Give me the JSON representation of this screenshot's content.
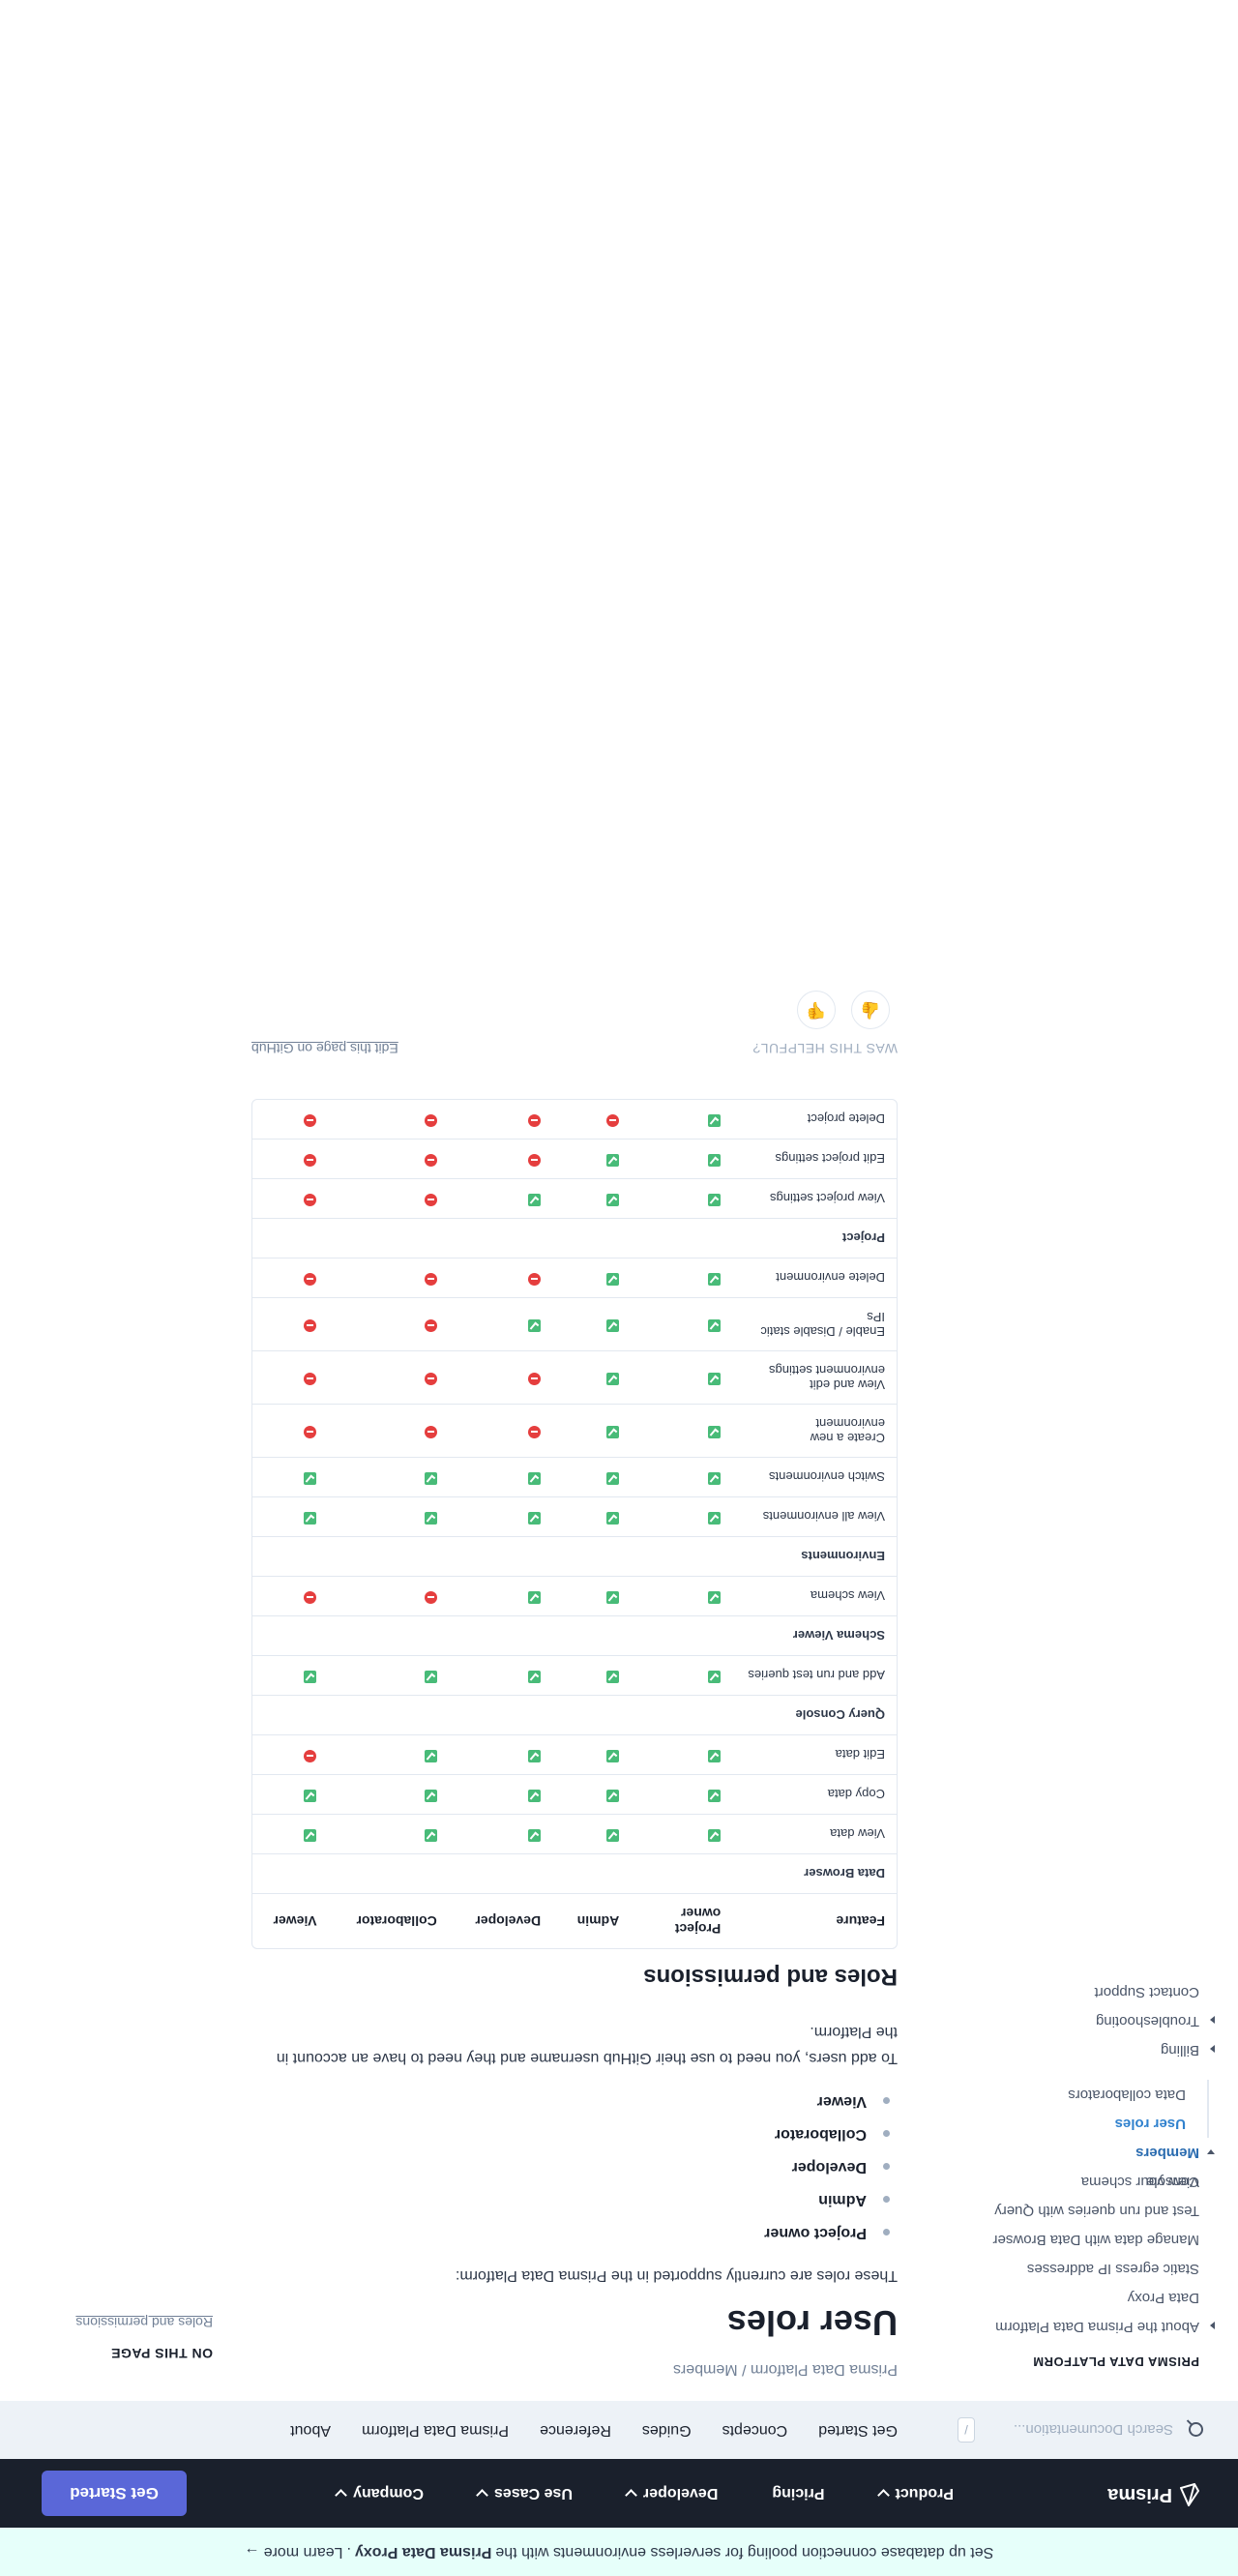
{
  "announcement": {
    "text": "Set up database connection pooling for serverless environments with the",
    "bold": "Prisma Data Proxy",
    "suffix": ".",
    "more": "Learn more",
    "arrow": "→"
  },
  "nav": {
    "logo": "Prisma",
    "links": [
      {
        "label": "Product",
        "dropdown": true
      },
      {
        "label": "Pricing",
        "dropdown": false
      },
      {
        "label": "Developer",
        "dropdown": true
      },
      {
        "label": "Use Cases",
        "dropdown": true
      },
      {
        "label": "Company",
        "dropdown": true
      }
    ],
    "cta": "Get Started"
  },
  "subnav": {
    "search_placeholder": "Search Documentation...",
    "shortcut": "/",
    "tabs": [
      "Get Started",
      "Concepts",
      "Guides",
      "Reference",
      "Prisma Data Platform",
      "About"
    ]
  },
  "sidebar": {
    "title": "PRISMA DATA PLATFORM",
    "items": [
      {
        "label": "About the Prisma Data Platform",
        "expandable": true
      },
      {
        "label": "Data Proxy"
      },
      {
        "label": "Static egress IP addresses"
      },
      {
        "label": "Manage data with Data Browser"
      },
      {
        "label": "Test and run queries with Query Console"
      },
      {
        "label": "View your schema"
      }
    ],
    "members": {
      "label": "Members",
      "children": [
        "User roles",
        "Data collaborators"
      ]
    },
    "after": [
      {
        "label": "Billing",
        "expandable": true
      },
      {
        "label": "Troubleshooting",
        "expandable": true
      },
      {
        "label": "Contact Support"
      }
    ]
  },
  "main": {
    "breadcrumb": "Prisma Data Platform / Members",
    "title": "User roles",
    "intro": "These roles are currently supported in the Prisma Data Platform:",
    "roles": [
      "Project owner",
      "Admin",
      "Developer",
      "Collaborator",
      "Viewer"
    ],
    "add_users": "To add users, you need to use their GitHub username and they need to have an account in the Platform.",
    "perm_heading": "Roles and permissions",
    "table": {
      "headers": [
        "Feature",
        "Project owner",
        "Admin",
        "Developer",
        "Collaborator",
        "Viewer"
      ],
      "rows": [
        {
          "section": "Data Browser"
        },
        {
          "feature": "View data",
          "perms": [
            "yes",
            "yes",
            "yes",
            "yes",
            "yes"
          ]
        },
        {
          "feature": "Copy data",
          "perms": [
            "yes",
            "yes",
            "yes",
            "yes",
            "yes"
          ]
        },
        {
          "feature": "Edit data",
          "perms": [
            "yes",
            "yes",
            "yes",
            "yes",
            "no"
          ]
        },
        {
          "section": "Query Console"
        },
        {
          "feature": "Add and run test queries",
          "perms": [
            "yes",
            "yes",
            "yes",
            "yes",
            "yes"
          ]
        },
        {
          "section": "Schema Viewer"
        },
        {
          "feature": "View schema",
          "perms": [
            "yes",
            "yes",
            "yes",
            "no",
            "no"
          ]
        },
        {
          "section": "Environments"
        },
        {
          "feature": "View all environments",
          "perms": [
            "yes",
            "yes",
            "yes",
            "yes",
            "yes"
          ]
        },
        {
          "feature": "Switch environments",
          "perms": [
            "yes",
            "yes",
            "yes",
            "yes",
            "yes"
          ]
        },
        {
          "feature": "Create a new environment",
          "perms": [
            "yes",
            "yes",
            "no",
            "no",
            "no"
          ]
        },
        {
          "feature": "View and edit environment settings",
          "perms": [
            "yes",
            "yes",
            "no",
            "no",
            "no"
          ]
        },
        {
          "feature": "Enable / Disable static IPs",
          "perms": [
            "yes",
            "yes",
            "yes",
            "no",
            "no"
          ]
        },
        {
          "feature": "Delete environment",
          "perms": [
            "yes",
            "yes",
            "no",
            "no",
            "no"
          ]
        },
        {
          "section": "Project"
        },
        {
          "feature": "View project settings",
          "perms": [
            "yes",
            "yes",
            "yes",
            "no",
            "no"
          ]
        },
        {
          "feature": "Edit project settings",
          "perms": [
            "yes",
            "yes",
            "no",
            "no",
            "no"
          ]
        },
        {
          "feature": "Delete project",
          "perms": [
            "yes",
            "no",
            "no",
            "no",
            "no"
          ]
        }
      ]
    },
    "feedback": {
      "question": "WAS THIS HELPFUL?",
      "edit": "Edit this page on GitHub"
    }
  },
  "toc": {
    "title": "ON THIS PAGE",
    "links": [
      "Roles and permissions"
    ]
  }
}
